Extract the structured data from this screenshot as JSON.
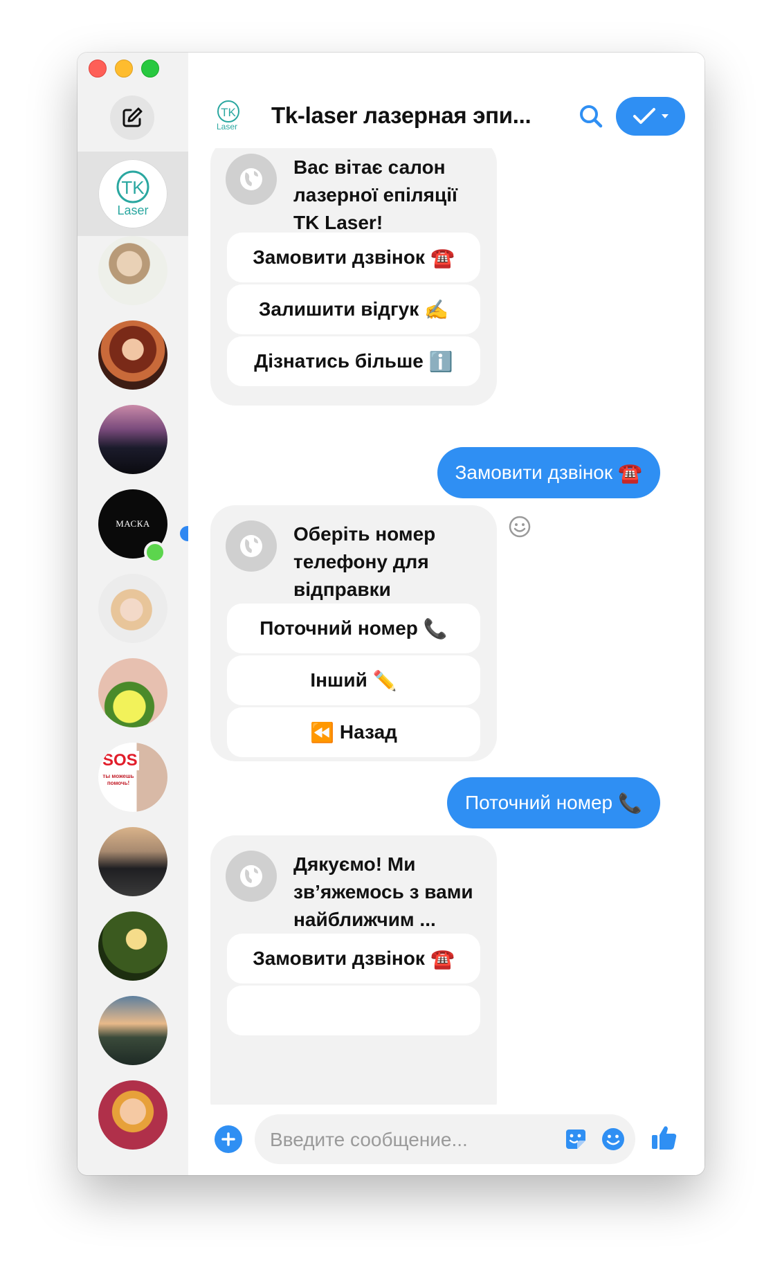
{
  "colors": {
    "accent": "#2f8ff3",
    "online": "#5cd54d",
    "card_bg": "#f2f2f2",
    "sidebar_bg": "#f2f2f2"
  },
  "window": {
    "traffic_lights": [
      "close",
      "minimize",
      "maximize"
    ]
  },
  "sidebar": {
    "compose_icon": "compose-icon",
    "contacts": [
      {
        "id": "tk-laser",
        "logo_text": "TK",
        "logo_sub": "Laser",
        "active": true
      },
      {
        "id": "contact-2"
      },
      {
        "id": "contact-3"
      },
      {
        "id": "contact-4"
      },
      {
        "id": "contact-maska",
        "label": "МАСКА",
        "online": true,
        "unread": true
      },
      {
        "id": "contact-6"
      },
      {
        "id": "contact-7"
      },
      {
        "id": "contact-sos",
        "label": "SOS",
        "sub": "ты можешь помочь!"
      },
      {
        "id": "contact-9"
      },
      {
        "id": "contact-10"
      },
      {
        "id": "contact-11"
      },
      {
        "id": "contact-12"
      }
    ]
  },
  "header": {
    "logo_text": "TK",
    "logo_sub": "Laser",
    "title": "Tk-laser лазерная эпи...",
    "search_icon": "search-icon",
    "done_icon": "checkmark-icon"
  },
  "messages": [
    {
      "type": "bot",
      "text": "Вас вітає салон лазерної епіляції TK Laser!",
      "buttons": [
        {
          "label": "Замовити дзвінок",
          "emoji": "☎️"
        },
        {
          "label": "Залишити відгук",
          "emoji": "✍️"
        },
        {
          "label": "Дізнатись більше",
          "emoji": "ℹ️"
        }
      ]
    },
    {
      "type": "user",
      "text": "Замовити дзвінок",
      "emoji": "☎️"
    },
    {
      "type": "bot",
      "text": "Оберіть номер телефону для відправки",
      "buttons": [
        {
          "label": "Поточний номер",
          "emoji": "📞"
        },
        {
          "label": "Інший",
          "emoji": "✏️"
        },
        {
          "label": "Назад",
          "emoji": "⏪"
        }
      ]
    },
    {
      "type": "user",
      "text": "Поточний номер",
      "emoji": "📞"
    },
    {
      "type": "bot",
      "text": "Дякуємо! Ми зв’яжемось з вами найближчим ...",
      "buttons": [
        {
          "label": "Замовити дзвінок",
          "emoji": "☎️"
        }
      ]
    }
  ],
  "composer": {
    "placeholder": "Введите сообщение...",
    "add_icon": "plus-icon",
    "sticker_icon": "sticker-icon",
    "emoji_icon": "smile-icon",
    "like_icon": "thumbs-up-icon"
  }
}
